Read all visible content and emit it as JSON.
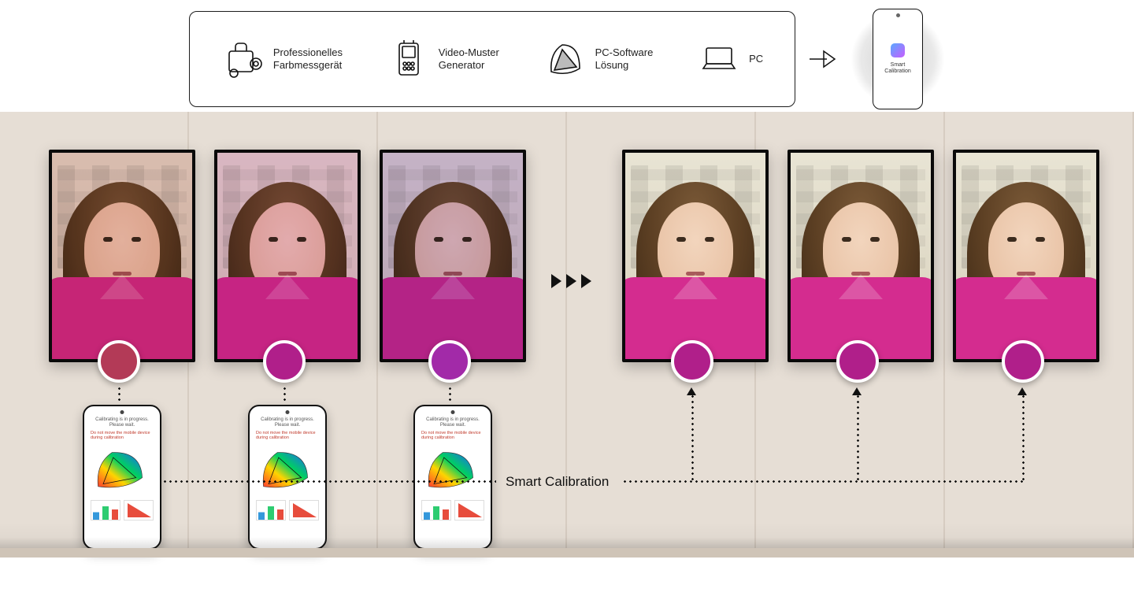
{
  "equipment": {
    "colorimeter_label": "Professionelles\nFarbmessgerät",
    "patterngen_label": "Video-Muster\nGenerator",
    "pcsoft_label": "PC-Software\nLösung",
    "pc_label": "PC"
  },
  "phone_app": {
    "app_name": "Smart\nCalibration",
    "status_line": "Calibrating is in progress. Please wait.",
    "warning_line": "Do not move the mobile device during calibration"
  },
  "caption": "Smart Calibration",
  "swatches": {
    "before": [
      "#b33a57",
      "#b01f8a",
      "#a22aa8"
    ],
    "after": [
      "#b01f8a",
      "#b01f8a",
      "#b01f8a"
    ]
  },
  "tints": {
    "before": [
      "#d08080",
      "#d070c0",
      "#9060d0"
    ],
    "after": [
      "#ffffff",
      "#ffffff",
      "#ffffff"
    ]
  },
  "blazer_color": "#d42c8f"
}
